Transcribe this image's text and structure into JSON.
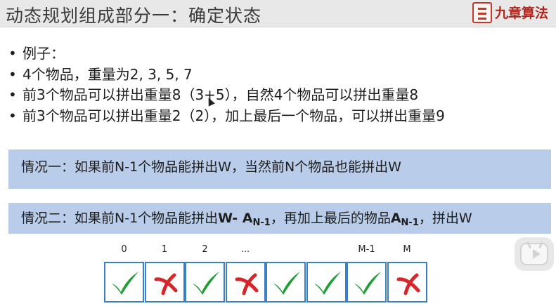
{
  "header": {
    "title": "动态规划组成部分一：确定状态",
    "brand": "九章算法"
  },
  "bullets": [
    "例子：",
    "4个物品，重量为2, 3, 5, 7",
    "前3个物品可以拼出重量8（3+5），自然4个物品可以拼出重量8",
    "前3个物品可以拼出重量2（2），加上最后一个物品，可以拼出重量9"
  ],
  "bullet_marker": "•",
  "case1": {
    "text": "情况一：如果前N-1个物品能拼出W，当然前N个物品也能拼出W"
  },
  "case2": {
    "prefix": "情况二：如果前N-1个物品能拼出",
    "w_minus": "W- A",
    "sub1": "N-1",
    "middle": "，再加上最后的物品",
    "a": "A",
    "sub2": "N-1",
    "suffix": "，拼出W"
  },
  "grid": {
    "labels": [
      "0",
      "1",
      "2",
      "...",
      "",
      "",
      "M-1",
      "M"
    ],
    "cells": [
      "check",
      "cross",
      "check",
      "cross",
      "check",
      "check",
      "check",
      "cross"
    ],
    "colors": {
      "check": "#1f9e34",
      "cross": "#d9252a",
      "border": "#3b7fc4"
    }
  }
}
